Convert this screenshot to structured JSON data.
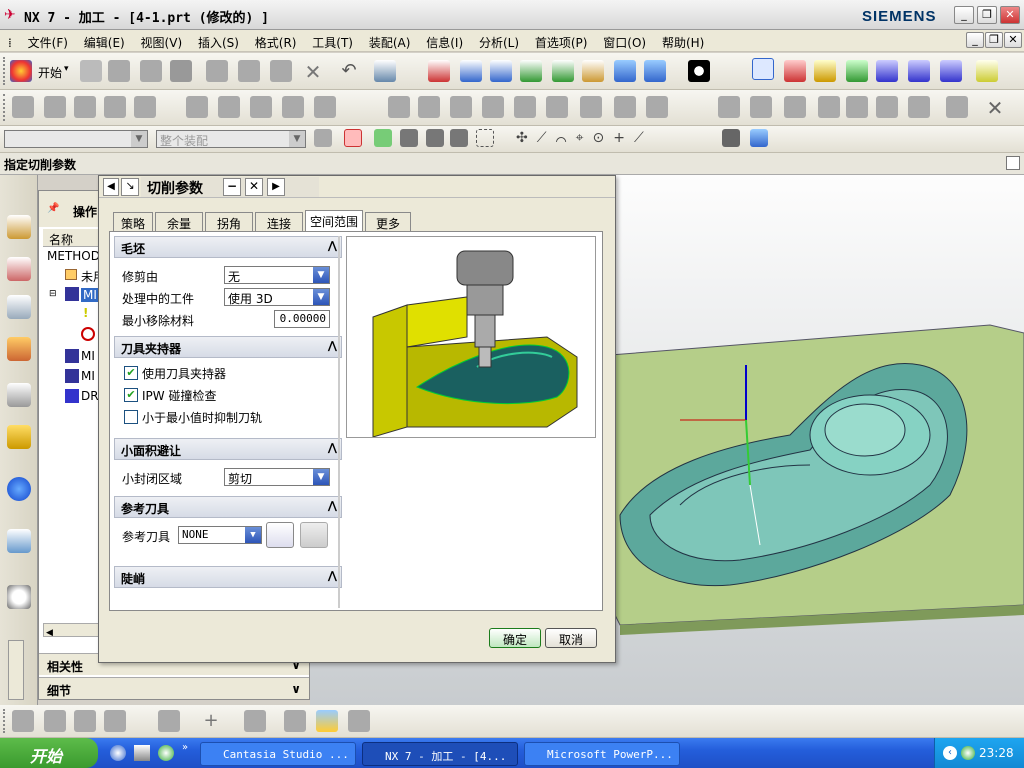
{
  "window": {
    "title": "NX 7 - 加工 - [4-1.prt  (修改的) ]",
    "brand": "SIEMENS"
  },
  "menubar": [
    "文件(F)",
    "编辑(E)",
    "视图(V)",
    "插入(S)",
    "格式(R)",
    "工具(T)",
    "装配(A)",
    "信息(I)",
    "分析(L)",
    "首选项(P)",
    "窗口(O)",
    "帮助(H)"
  ],
  "toolbar": {
    "start_label": "开始",
    "filter_value": "整个装配"
  },
  "cue_line": "指定切削参数",
  "navigator": {
    "header": "操作",
    "column": "名称",
    "rows": [
      "METHOD",
      "未用",
      "MI",
      "MI",
      "MI",
      "DR"
    ],
    "relations": "相关性",
    "details": "细节"
  },
  "dialog": {
    "title": "切削参数",
    "tabs": [
      "策略",
      "余量",
      "拐角",
      "连接",
      "空间范围",
      "更多"
    ],
    "active_tab": "空间范围",
    "blank": {
      "header": "毛坯",
      "trim_label": "修剪由",
      "trim_value": "无",
      "ipw_label": "处理中的工件",
      "ipw_value": "使用 3D",
      "min_remove_label": "最小移除材料",
      "min_remove_value": "0.00000"
    },
    "holder": {
      "header": "刀具夹持器",
      "use_holder": "使用刀具夹持器",
      "ipw_check": "IPW 碰撞检查",
      "suppress": "小于最小值时抑制刀轨"
    },
    "small_area": {
      "header": "小面积避让",
      "label": "小封闭区域",
      "value": "剪切"
    },
    "ref_tool": {
      "header": "参考刀具",
      "label": "参考刀具",
      "value": "NONE"
    },
    "steep": {
      "header": "陡峭"
    },
    "ok": "确定",
    "cancel": "取消"
  },
  "taskbar": {
    "start": "开始",
    "tasks": [
      "Cantasia Studio ...",
      "NX 7 - 加工 - [4...",
      "Microsoft PowerP..."
    ],
    "time": "23:28"
  }
}
